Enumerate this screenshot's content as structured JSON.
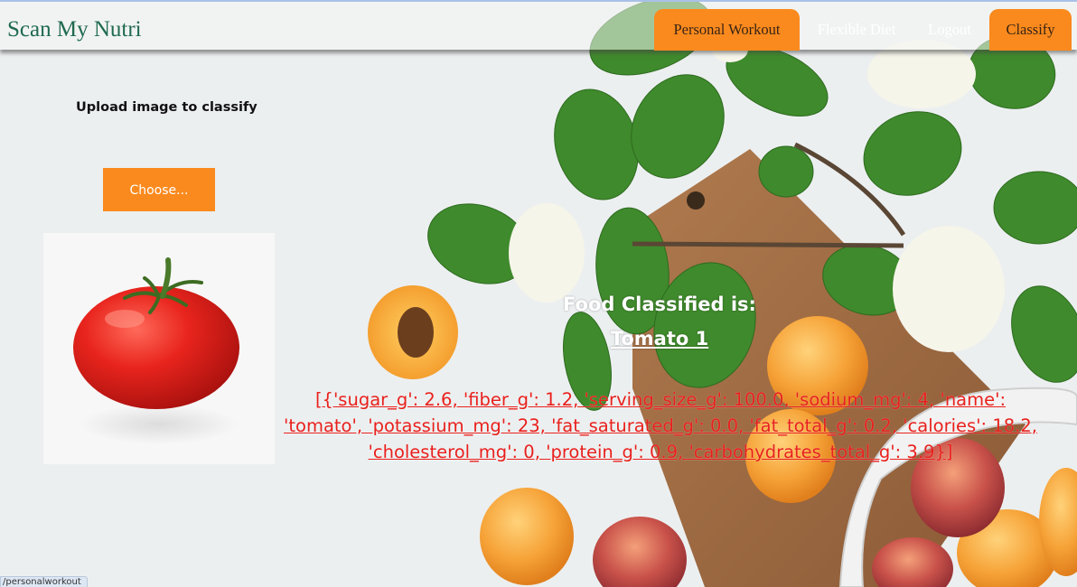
{
  "header": {
    "brand": "Scan My Nutri",
    "nav": [
      {
        "label": "Personal Workout"
      },
      {
        "label": "Flexible Diet"
      },
      {
        "label": "Logout"
      },
      {
        "label": "Classify"
      }
    ]
  },
  "upload": {
    "label": "Upload image to classify",
    "choose_button": "Choose..."
  },
  "result": {
    "title": "Food Classified is:",
    "food": "Tomato 1",
    "nutrition_text": "[{'sugar_g': 2.6, 'fiber_g': 1.2, 'serving_size_g': 100.0, 'sodium_mg': 4, 'name': 'tomato', 'potassium_mg': 23, 'fat_saturated_g': 0.0, 'fat_total_g': 0.2, 'calories': 18.2, 'cholesterol_mg': 0, 'protein_g': 0.9, 'carbohydrates_total_g': 3.9}]"
  },
  "status_bar": {
    "url": "/personalworkout"
  },
  "colors": {
    "accent_orange": "#fa8a1e",
    "brand_green": "#1f6a4e",
    "result_red": "#e8201c"
  }
}
